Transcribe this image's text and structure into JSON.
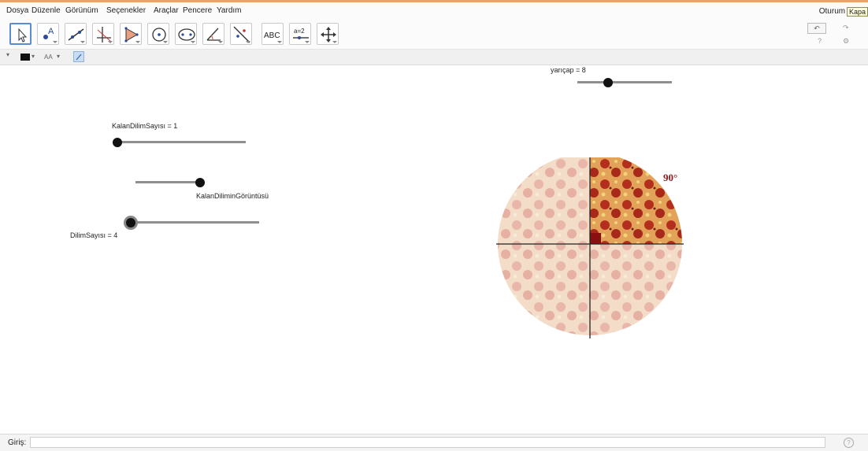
{
  "menubar": {
    "items": [
      "Dosya",
      "Düzenle",
      "Görünüm",
      "Seçenekler",
      "Araçlar",
      "Pencere",
      "Yardım"
    ],
    "login": "Oturum A",
    "close_tooltip": "Kapa"
  },
  "toolbar": {
    "tools": [
      {
        "icon": "move-arrow-icon"
      },
      {
        "icon": "point-icon"
      },
      {
        "icon": "line-icon"
      },
      {
        "icon": "perpendicular-line-icon"
      },
      {
        "icon": "polygon-icon"
      },
      {
        "icon": "circle-center-point-icon"
      },
      {
        "icon": "ellipse-icon"
      },
      {
        "icon": "angle-icon"
      },
      {
        "icon": "reflect-icon"
      },
      {
        "icon": "text-tool-icon",
        "text": "ABC"
      },
      {
        "icon": "slider-tool-icon",
        "text": "a=2"
      },
      {
        "icon": "move-graphics-view-icon"
      }
    ]
  },
  "stylebar": {
    "font_size_label": "AA"
  },
  "sliders": {
    "radius": {
      "label": "yarıçap = 8",
      "fraction": 0.35
    },
    "remaining_slices": {
      "label": "KalanDilimSayısı = 1",
      "fraction": 0.0
    },
    "remaining_slice_view": {
      "label": "KalanDiliminGörüntüsü",
      "fraction": 1.0
    },
    "slice_count": {
      "label": "DilimSayısı = 4",
      "fraction": 0.0
    }
  },
  "pizza": {
    "angle_label": "90°",
    "slice_count": 4,
    "highlight_color": "#9a2f20",
    "angle_text_color": "#8b1a1a"
  },
  "input_bar": {
    "label": "Giriş:",
    "value": ""
  }
}
